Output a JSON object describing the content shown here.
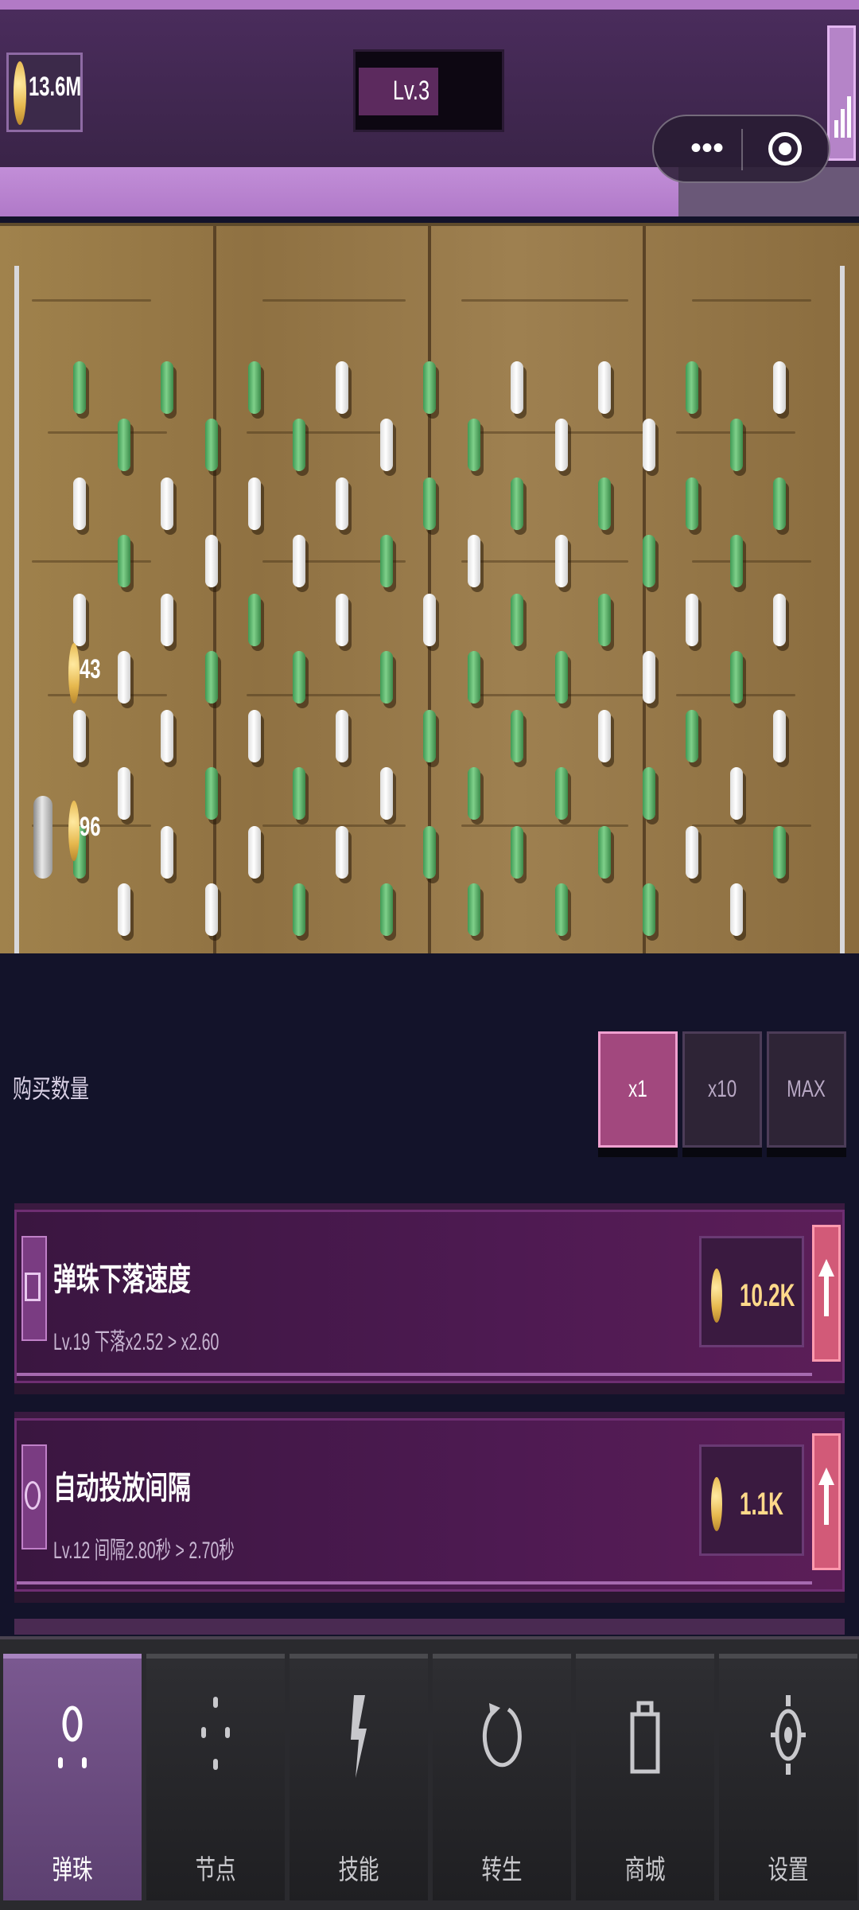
{
  "header": {
    "coin_amount": "13.6M",
    "level_label": "Lv.3",
    "level_progress": 0.55,
    "xp_progress": 0.79
  },
  "board": {
    "coin_drops": [
      {
        "value": "43"
      },
      {
        "value": "96"
      }
    ]
  },
  "purchase": {
    "label": "购买数量",
    "options": [
      "x1",
      "x10",
      "MAX"
    ],
    "selected": "x1"
  },
  "upgrades": [
    {
      "title": "弹珠下落速度",
      "desc": "Lv.19 下落x2.52 > x2.60",
      "price": "10.2K",
      "icon": "speed-icon"
    },
    {
      "title": "自动投放间隔",
      "desc": "Lv.12 间隔2.80秒 > 2.70秒",
      "price": "1.1K",
      "icon": "timer-icon"
    }
  ],
  "nav": {
    "items": [
      {
        "label": "弹珠",
        "icon": "marble-icon",
        "active": true
      },
      {
        "label": "节点",
        "icon": "node-icon",
        "active": false
      },
      {
        "label": "技能",
        "icon": "lightning-icon",
        "active": false
      },
      {
        "label": "转生",
        "icon": "rebirth-icon",
        "active": false
      },
      {
        "label": "商城",
        "icon": "shop-icon",
        "active": false
      },
      {
        "label": "设置",
        "icon": "gear-icon",
        "active": false
      }
    ]
  },
  "colors": {
    "accent": "#b27ac6",
    "board": "#9a7c4c",
    "peg_green": "#5fb56e",
    "price": "#ffd98a"
  }
}
